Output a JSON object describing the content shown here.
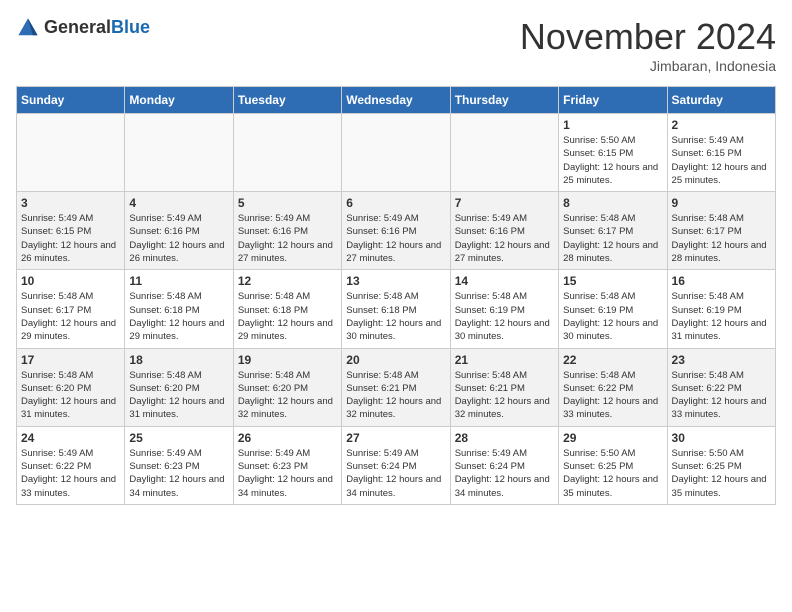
{
  "logo": {
    "general": "General",
    "blue": "Blue"
  },
  "title": "November 2024",
  "location": "Jimbaran, Indonesia",
  "days_of_week": [
    "Sunday",
    "Monday",
    "Tuesday",
    "Wednesday",
    "Thursday",
    "Friday",
    "Saturday"
  ],
  "weeks": [
    [
      {
        "day": "",
        "info": ""
      },
      {
        "day": "",
        "info": ""
      },
      {
        "day": "",
        "info": ""
      },
      {
        "day": "",
        "info": ""
      },
      {
        "day": "",
        "info": ""
      },
      {
        "day": "1",
        "info": "Sunrise: 5:50 AM\nSunset: 6:15 PM\nDaylight: 12 hours and 25 minutes."
      },
      {
        "day": "2",
        "info": "Sunrise: 5:49 AM\nSunset: 6:15 PM\nDaylight: 12 hours and 25 minutes."
      }
    ],
    [
      {
        "day": "3",
        "info": "Sunrise: 5:49 AM\nSunset: 6:15 PM\nDaylight: 12 hours and 26 minutes."
      },
      {
        "day": "4",
        "info": "Sunrise: 5:49 AM\nSunset: 6:16 PM\nDaylight: 12 hours and 26 minutes."
      },
      {
        "day": "5",
        "info": "Sunrise: 5:49 AM\nSunset: 6:16 PM\nDaylight: 12 hours and 27 minutes."
      },
      {
        "day": "6",
        "info": "Sunrise: 5:49 AM\nSunset: 6:16 PM\nDaylight: 12 hours and 27 minutes."
      },
      {
        "day": "7",
        "info": "Sunrise: 5:49 AM\nSunset: 6:16 PM\nDaylight: 12 hours and 27 minutes."
      },
      {
        "day": "8",
        "info": "Sunrise: 5:48 AM\nSunset: 6:17 PM\nDaylight: 12 hours and 28 minutes."
      },
      {
        "day": "9",
        "info": "Sunrise: 5:48 AM\nSunset: 6:17 PM\nDaylight: 12 hours and 28 minutes."
      }
    ],
    [
      {
        "day": "10",
        "info": "Sunrise: 5:48 AM\nSunset: 6:17 PM\nDaylight: 12 hours and 29 minutes."
      },
      {
        "day": "11",
        "info": "Sunrise: 5:48 AM\nSunset: 6:18 PM\nDaylight: 12 hours and 29 minutes."
      },
      {
        "day": "12",
        "info": "Sunrise: 5:48 AM\nSunset: 6:18 PM\nDaylight: 12 hours and 29 minutes."
      },
      {
        "day": "13",
        "info": "Sunrise: 5:48 AM\nSunset: 6:18 PM\nDaylight: 12 hours and 30 minutes."
      },
      {
        "day": "14",
        "info": "Sunrise: 5:48 AM\nSunset: 6:19 PM\nDaylight: 12 hours and 30 minutes."
      },
      {
        "day": "15",
        "info": "Sunrise: 5:48 AM\nSunset: 6:19 PM\nDaylight: 12 hours and 30 minutes."
      },
      {
        "day": "16",
        "info": "Sunrise: 5:48 AM\nSunset: 6:19 PM\nDaylight: 12 hours and 31 minutes."
      }
    ],
    [
      {
        "day": "17",
        "info": "Sunrise: 5:48 AM\nSunset: 6:20 PM\nDaylight: 12 hours and 31 minutes."
      },
      {
        "day": "18",
        "info": "Sunrise: 5:48 AM\nSunset: 6:20 PM\nDaylight: 12 hours and 31 minutes."
      },
      {
        "day": "19",
        "info": "Sunrise: 5:48 AM\nSunset: 6:20 PM\nDaylight: 12 hours and 32 minutes."
      },
      {
        "day": "20",
        "info": "Sunrise: 5:48 AM\nSunset: 6:21 PM\nDaylight: 12 hours and 32 minutes."
      },
      {
        "day": "21",
        "info": "Sunrise: 5:48 AM\nSunset: 6:21 PM\nDaylight: 12 hours and 32 minutes."
      },
      {
        "day": "22",
        "info": "Sunrise: 5:48 AM\nSunset: 6:22 PM\nDaylight: 12 hours and 33 minutes."
      },
      {
        "day": "23",
        "info": "Sunrise: 5:48 AM\nSunset: 6:22 PM\nDaylight: 12 hours and 33 minutes."
      }
    ],
    [
      {
        "day": "24",
        "info": "Sunrise: 5:49 AM\nSunset: 6:22 PM\nDaylight: 12 hours and 33 minutes."
      },
      {
        "day": "25",
        "info": "Sunrise: 5:49 AM\nSunset: 6:23 PM\nDaylight: 12 hours and 34 minutes."
      },
      {
        "day": "26",
        "info": "Sunrise: 5:49 AM\nSunset: 6:23 PM\nDaylight: 12 hours and 34 minutes."
      },
      {
        "day": "27",
        "info": "Sunrise: 5:49 AM\nSunset: 6:24 PM\nDaylight: 12 hours and 34 minutes."
      },
      {
        "day": "28",
        "info": "Sunrise: 5:49 AM\nSunset: 6:24 PM\nDaylight: 12 hours and 34 minutes."
      },
      {
        "day": "29",
        "info": "Sunrise: 5:50 AM\nSunset: 6:25 PM\nDaylight: 12 hours and 35 minutes."
      },
      {
        "day": "30",
        "info": "Sunrise: 5:50 AM\nSunset: 6:25 PM\nDaylight: 12 hours and 35 minutes."
      }
    ]
  ]
}
